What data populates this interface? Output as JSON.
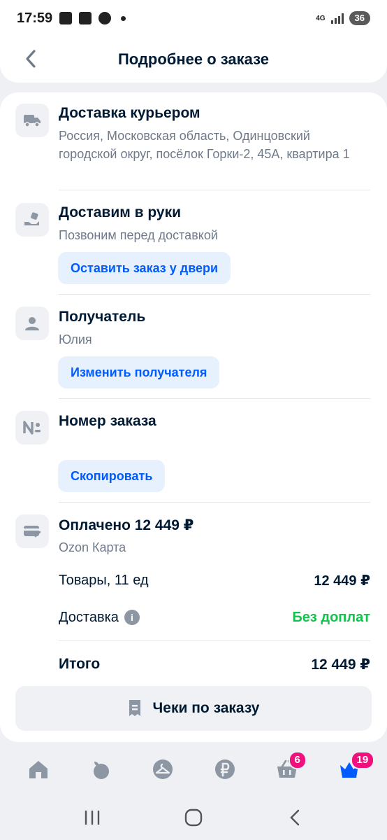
{
  "status_bar": {
    "time": "17:59",
    "network": "4G",
    "battery": "36"
  },
  "header": {
    "title": "Подробнее о заказе"
  },
  "delivery": {
    "title": "Доставка курьером",
    "address": "Россия, Московская область, Одинцовский городской округ, посёлок Горки-2, 45А, квартира 1"
  },
  "handover": {
    "title": "Доставим в руки",
    "subtitle": "Позвоним перед доставкой",
    "button": "Оставить заказ у двери"
  },
  "recipient": {
    "title": "Получатель",
    "name": "Юлия",
    "button": "Изменить получателя"
  },
  "order_number": {
    "title": "Номер заказа",
    "button": "Скопировать"
  },
  "payment": {
    "title": "Оплачено 12 449 ₽",
    "method": "Ozon Карта",
    "goods_label": "Товары, 11 ед",
    "goods_value": "12 449 ₽",
    "delivery_label": "Доставка",
    "delivery_value": "Без доплат",
    "total_label": "Итого",
    "total_value": "12 449 ₽"
  },
  "receipts": {
    "label": "Чеки по заказу"
  },
  "bottom_nav": {
    "cart_badge": "6",
    "profile_badge": "19"
  },
  "colors": {
    "accent": "#005bff",
    "pill_bg": "#e6f1fd",
    "green": "#10c44c",
    "badge": "#f1117e"
  }
}
